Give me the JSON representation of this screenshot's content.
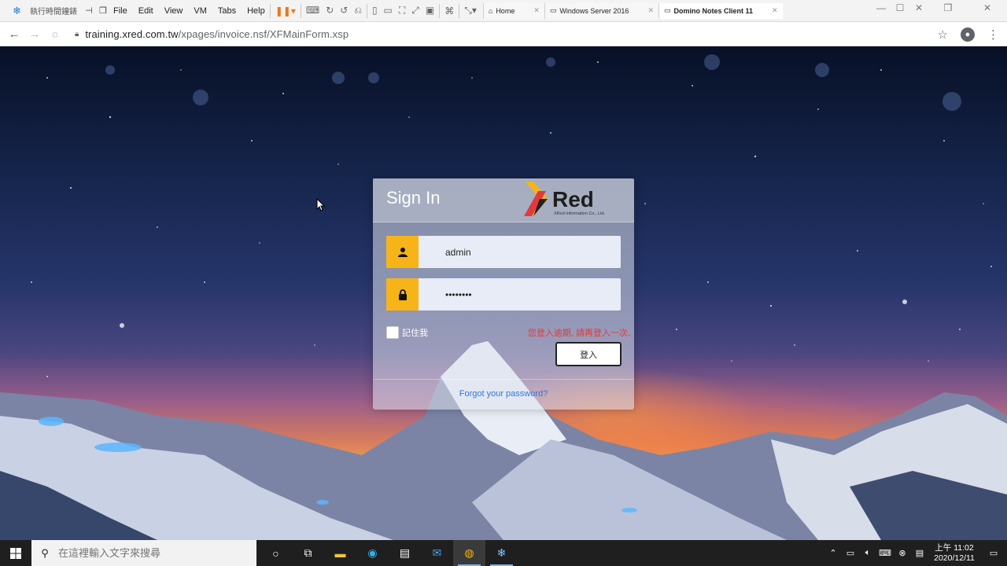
{
  "vm": {
    "app_title": "執行時間鐘錶",
    "menu": [
      "File",
      "Edit",
      "View",
      "VM",
      "Tabs",
      "Help"
    ],
    "tabs": [
      {
        "label": "Home",
        "icon": "home-icon"
      },
      {
        "label": "Windows Server 2016",
        "icon": "vm-tab-icon"
      },
      {
        "label": "Domino Notes Client 11",
        "icon": "vm-tab-icon",
        "active": true
      }
    ]
  },
  "browser": {
    "url_host": "training.xred.com.tw",
    "url_path": "/xpages/invoice.nsf/XFMainForm.xsp"
  },
  "login": {
    "title": "Sign In",
    "logo_text": "Red",
    "logo_sub": "XRed Information Co., Ltd.",
    "username_value": "admin",
    "password_value": "••••••••",
    "remember_label": "記住我",
    "error_message": "您登入逾期, 請再登入一次.",
    "login_button": "登入",
    "forgot_link": "Forgot your password?",
    "accent_color": "#f6b419",
    "error_color": "#e23a3a"
  },
  "taskbar": {
    "search_placeholder": "在這裡輸入文字來搜尋",
    "clock_time": "上午 11:02",
    "clock_date": "2020/12/11"
  }
}
